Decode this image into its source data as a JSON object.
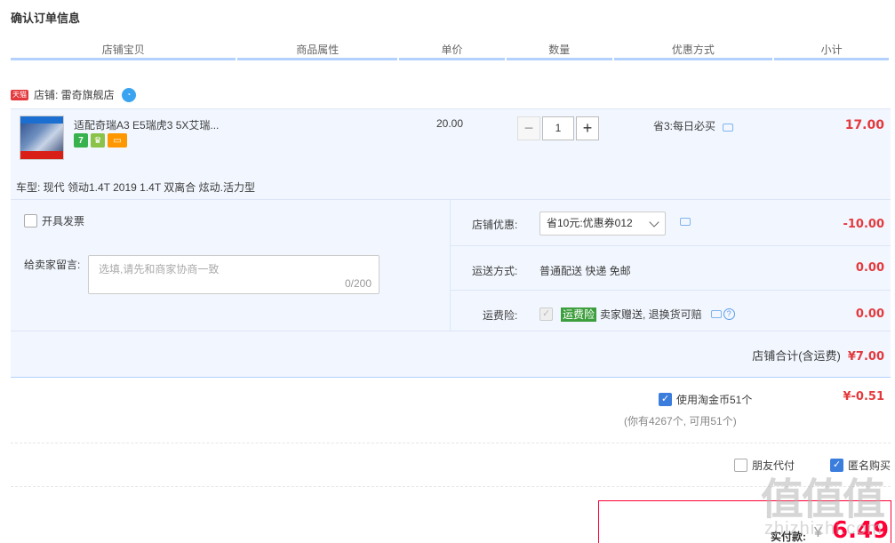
{
  "page": {
    "title": "确认订单信息"
  },
  "columns": [
    "店铺宝贝",
    "商品属性",
    "单价",
    "数量",
    "优惠方式",
    "小计"
  ],
  "shop": {
    "badge": "天猫",
    "label": "店铺: 雷奇旗舰店",
    "chat_icon": "wangwang-icon"
  },
  "item": {
    "name": "适配奇瑞A3 E5瑞虎3 5X艾瑞...",
    "unit_price": "20.00",
    "quantity": "1",
    "qty_minus": "−",
    "qty_plus": "+",
    "promo": "省3:每日必买",
    "subtotal": "17.00",
    "attribute": "车型: 现代 领动1.4T 2019 1.4T 双离合 炫动.活力型",
    "badge_icons": [
      "seven-day-return-icon",
      "guarantee-icon",
      "card-icon"
    ]
  },
  "invoice": {
    "label": "开具发票",
    "checked": false
  },
  "message": {
    "label": "给卖家留言:",
    "placeholder": "选填,请先和商家协商一致",
    "counter": "0/200"
  },
  "shop_coupon": {
    "label": "店铺优惠:",
    "selected": "省10元:优惠券012",
    "amount": "-10.00"
  },
  "shipping": {
    "label": "运送方式:",
    "value": "普通配送 快递 免邮",
    "amount": "0.00"
  },
  "insurance": {
    "label": "运费险:",
    "badge": "运费险",
    "text": "卖家赠送, 退换货可赔",
    "amount": "0.00",
    "help": "?"
  },
  "shop_total": {
    "label": "店铺合计(含运费)",
    "amount": "¥7.00"
  },
  "coins": {
    "label": "使用淘金币51个",
    "amount": "¥-0.51",
    "note": "(你有4267个, 可用51个)",
    "checked": true
  },
  "options": {
    "friend_pay": "朋友代付",
    "anonymous": "匿名购买"
  },
  "payment": {
    "label": "实付款:",
    "currency": "¥",
    "amount": "6.49"
  },
  "watermark": {
    "main": "值值值",
    "sub": "zhizhizhi.com"
  },
  "colors": {
    "accent_red": "#e4393c",
    "header_underline": "#b2d1ff",
    "section_bg": "#f2f7ff",
    "checkbox_blue": "#3b7ddd"
  }
}
